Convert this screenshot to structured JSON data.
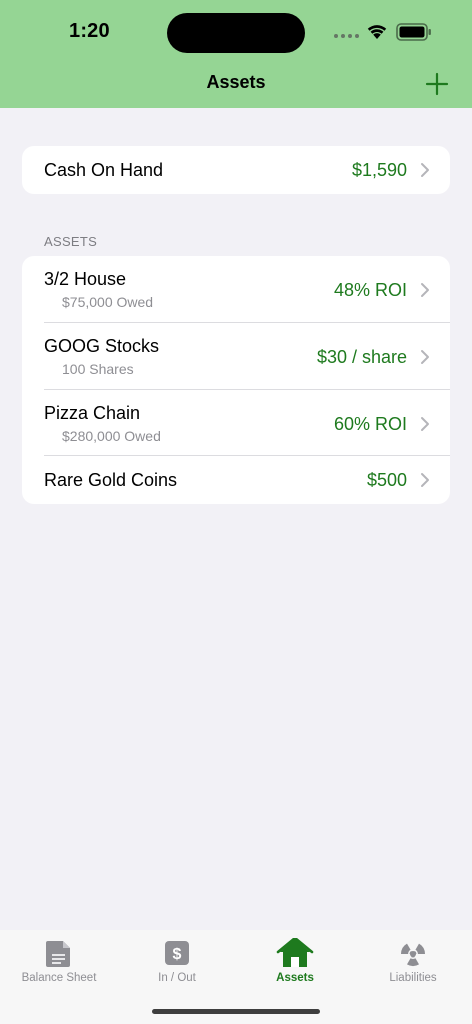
{
  "status": {
    "time": "1:20"
  },
  "nav": {
    "title": "Assets",
    "add_icon": "plus-icon"
  },
  "cash": {
    "label": "Cash On Hand",
    "value": "$1,590"
  },
  "assets_section": {
    "header": "ASSETS",
    "items": [
      {
        "title": "3/2 House",
        "subtitle": "$75,000 Owed",
        "value": "48% ROI"
      },
      {
        "title": "GOOG Stocks",
        "subtitle": "100 Shares",
        "value": "$30 / share"
      },
      {
        "title": "Pizza Chain",
        "subtitle": "$280,000 Owed",
        "value": "60% ROI"
      },
      {
        "title": "Rare Gold Coins",
        "subtitle": "",
        "value": "$500"
      }
    ]
  },
  "tabs": [
    {
      "label": "Balance Sheet",
      "icon": "document-icon",
      "active": false
    },
    {
      "label": "In / Out",
      "icon": "dollar-icon",
      "active": false
    },
    {
      "label": "Assets",
      "icon": "house-icon",
      "active": true
    },
    {
      "label": "Liabilities",
      "icon": "radiation-icon",
      "active": false
    }
  ],
  "colors": {
    "header_bg": "#95d594",
    "accent_green": "#1e7a1e",
    "background": "#f2f1f6",
    "inactive_gray": "#8e8e93"
  }
}
